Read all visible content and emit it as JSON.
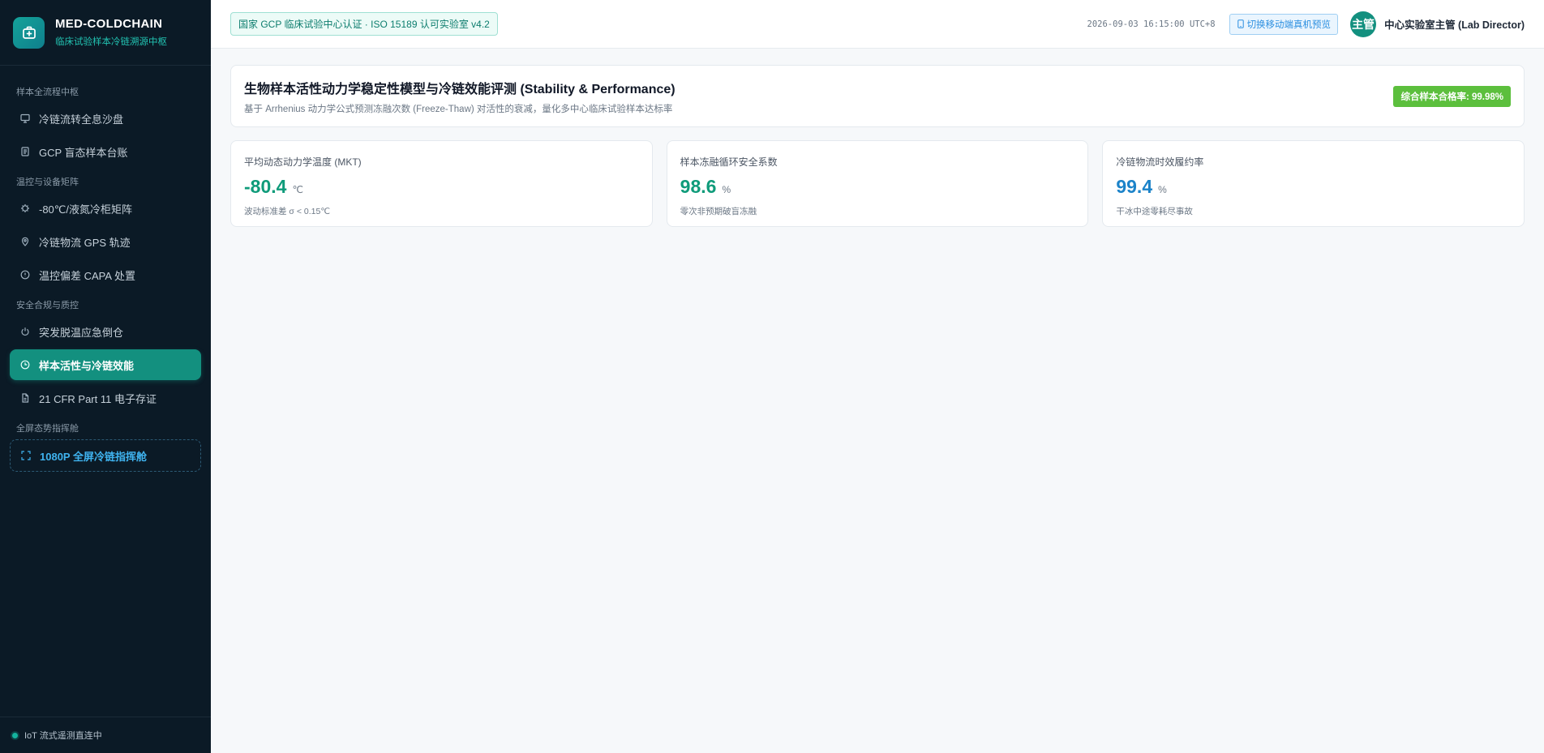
{
  "brand": {
    "title": "MED-COLDCHAIN",
    "subtitle": "临床试验样本冷链溯源中枢"
  },
  "sidebar": {
    "sections": [
      {
        "title": "样本全流程中枢",
        "items": [
          {
            "label": "冷链流转全息沙盘",
            "icon": "monitor-icon"
          },
          {
            "label": "GCP 盲态样本台账",
            "icon": "document-icon"
          }
        ]
      },
      {
        "title": "温控与设备矩阵",
        "items": [
          {
            "label": "-80℃/液氮冷柜矩阵",
            "icon": "chip-icon"
          },
          {
            "label": "冷链物流 GPS 轨迹",
            "icon": "location-pin-icon"
          },
          {
            "label": "温控偏差 CAPA 处置",
            "icon": "alert-circle-icon"
          }
        ]
      },
      {
        "title": "安全合规与质控",
        "items": [
          {
            "label": "突发脱温应急倒仓",
            "icon": "power-icon"
          },
          {
            "label": "样本活性与冷链效能",
            "icon": "clock-icon",
            "active": true
          },
          {
            "label": "21 CFR Part 11 电子存证",
            "icon": "file-icon"
          }
        ]
      },
      {
        "title": "全屏态势指挥舱",
        "items": [
          {
            "label": "1080P 全屏冷链指挥舱",
            "icon": "fullscreen-icon"
          }
        ]
      }
    ],
    "footer_status": "IoT 流式遥测直连中"
  },
  "topbar": {
    "cert_badge": "国家 GCP 临床试验中心认证 · ISO 15189 认可实验室 v4.2",
    "datetime": "2026-09-03 16:15:00 UTC+8",
    "switch_button": "切换移动端真机预览",
    "avatar_text": "主管",
    "user_name": "中心实验室主管 (Lab Director)"
  },
  "header": {
    "title": "生物样本活性动力学稳定性模型与冷链效能评测 (Stability & Performance)",
    "subtitle": "基于 Arrhenius 动力学公式预测冻融次数 (Freeze-Thaw) 对活性的衰减，量化多中心临床试验样本达标率",
    "rate_badge": "综合样本合格率: 99.98%"
  },
  "kpis": [
    {
      "label": "平均动态动力学温度 (MKT)",
      "value": "-80.4",
      "unit": "℃",
      "note": "波动标准差 σ < 0.15℃",
      "color": "#0f9b7a"
    },
    {
      "label": "样本冻融循环安全系数",
      "value": "98.6",
      "unit": "%",
      "note": "零次非预期破盲冻融",
      "color": "#0f9b7a"
    },
    {
      "label": "冷链物流时效履约率",
      "value": "99.4",
      "unit": "%",
      "note": "干冰中途零耗尽事故",
      "color": "#1c83c9"
    }
  ],
  "colors": {
    "accent": "#13907f",
    "sidebar_bg": "#0b1a26",
    "rate_badge_bg": "#5cbf3d",
    "link_blue": "#3fb3ef"
  }
}
